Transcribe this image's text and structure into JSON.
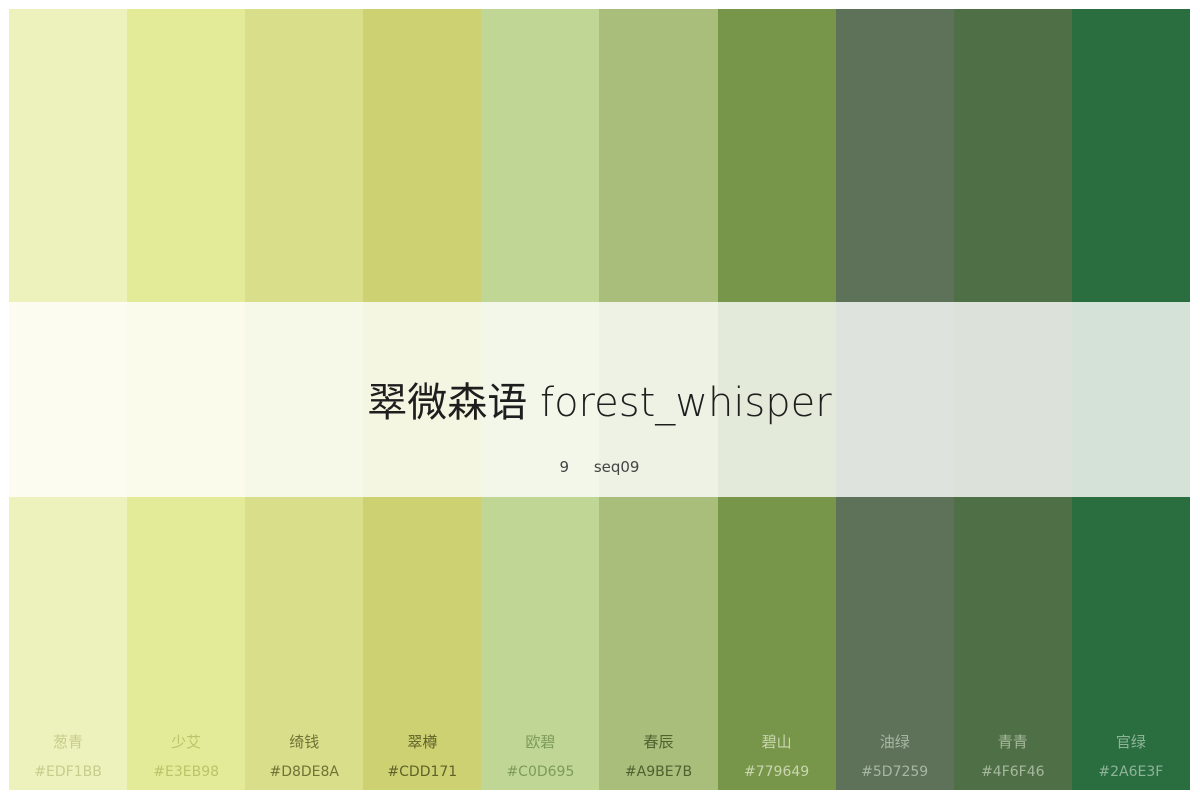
{
  "palette": {
    "name_cn": "翠微森语",
    "name_en": "forest_whisper",
    "count": "9",
    "code": "seq09",
    "colors": [
      {
        "name": "葱青",
        "hex": "#EDF1BB",
        "text_color": "#c8cc8c"
      },
      {
        "name": "少艾",
        "hex": "#E3EB98",
        "text_color": "#bcc46a"
      },
      {
        "name": "绮钱",
        "hex": "#D8DE8A",
        "text_color": "#6f7336"
      },
      {
        "name": "翠樽",
        "hex": "#CDD171",
        "text_color": "#5f6128"
      },
      {
        "name": "欧碧",
        "hex": "#C0D695",
        "text_color": "#7e9a5a"
      },
      {
        "name": "春辰",
        "hex": "#A9BE7B",
        "text_color": "#4e6230"
      },
      {
        "name": "碧山",
        "hex": "#779649",
        "text_color": "#c9d6b0"
      },
      {
        "name": "油绿",
        "hex": "#5D7259",
        "text_color": "#a8b6a4"
      },
      {
        "name": "青青",
        "hex": "#4F6F46",
        "text_color": "#a6b89e"
      },
      {
        "name": "官绿",
        "hex": "#2A6E3F",
        "text_color": "#8fb49a"
      }
    ]
  }
}
